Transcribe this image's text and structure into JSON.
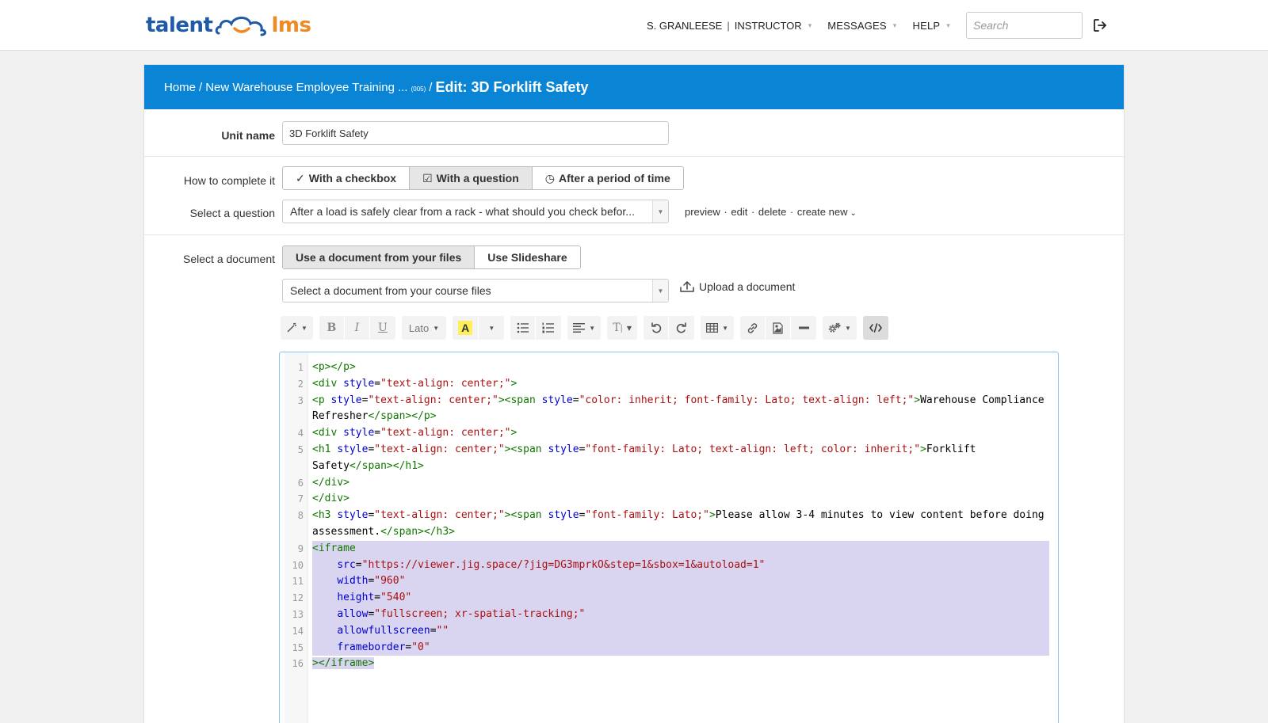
{
  "header": {
    "logo_left": "talent",
    "logo_right": "lms",
    "user_name": "S. GRANLEESE",
    "user_role": "INSTRUCTOR",
    "messages": "MESSAGES",
    "help": "HELP",
    "search_placeholder": "Search"
  },
  "breadcrumb": {
    "home": "Home",
    "course": "New Warehouse Employee Training ...",
    "count": "(005)",
    "current": "Edit: 3D Forklift Safety",
    "separator": "/"
  },
  "form": {
    "unit_name_label": "Unit name",
    "unit_name_value": "3D Forklift Safety",
    "complete_label": "How to complete it",
    "complete_options": [
      "With a checkbox",
      "With a question",
      "After a period of time"
    ],
    "complete_selected": "With a question",
    "question_label": "Select a question",
    "question_value": "After a load is safely clear from a rack - what should you check befor...",
    "question_links": [
      "preview",
      "edit",
      "delete",
      "create new"
    ],
    "document_label": "Select a document",
    "document_options": [
      "Use a document from your files",
      "Use Slideshare"
    ],
    "document_selected": "Use a document from your files",
    "document_select_value": "Select a document from your course files",
    "upload_label": "Upload a document"
  },
  "toolbar": {
    "font": "Lato",
    "bold": "B",
    "italic": "I",
    "underline": "U",
    "highlight": "A",
    "text_size": "T"
  },
  "code_lines": [
    {
      "n": "1",
      "segments": [
        [
          "tag",
          "<p></p>"
        ]
      ]
    },
    {
      "n": "2",
      "segments": [
        [
          "tag",
          "<div "
        ],
        [
          "attr",
          "style"
        ],
        [
          "txt",
          "="
        ],
        [
          "str",
          "\"text-align: center;\""
        ],
        [
          "tag",
          ">"
        ]
      ]
    },
    {
      "n": "3",
      "segments": [
        [
          "tag",
          "<p "
        ],
        [
          "attr",
          "style"
        ],
        [
          "txt",
          "="
        ],
        [
          "str",
          "\"text-align: center;\""
        ],
        [
          "tag",
          "><span "
        ],
        [
          "attr",
          "style"
        ],
        [
          "txt",
          "="
        ],
        [
          "str",
          "\"color: inherit; font-family: Lato; text-align: left;\""
        ],
        [
          "tag",
          ">"
        ],
        [
          "txt",
          "Warehouse Compliance Refresher"
        ],
        [
          "tag",
          "</span></p>"
        ]
      ]
    },
    {
      "n": "4",
      "segments": [
        [
          "tag",
          "<div "
        ],
        [
          "attr",
          "style"
        ],
        [
          "txt",
          "="
        ],
        [
          "str",
          "\"text-align: center;\""
        ],
        [
          "tag",
          ">"
        ]
      ]
    },
    {
      "n": "5",
      "segments": [
        [
          "tag",
          "<h1 "
        ],
        [
          "attr",
          "style"
        ],
        [
          "txt",
          "="
        ],
        [
          "str",
          "\"text-align: center;\""
        ],
        [
          "tag",
          "><span "
        ],
        [
          "attr",
          "style"
        ],
        [
          "txt",
          "="
        ],
        [
          "str",
          "\"font-family: Lato; text-align: left; color: inherit;\""
        ],
        [
          "tag",
          ">"
        ],
        [
          "txt",
          "Forklift Safety"
        ],
        [
          "tag",
          "</span></h1>"
        ]
      ]
    },
    {
      "n": "6",
      "segments": [
        [
          "tag",
          "</div>"
        ]
      ]
    },
    {
      "n": "7",
      "segments": [
        [
          "tag",
          "</div>"
        ]
      ]
    },
    {
      "n": "8",
      "segments": [
        [
          "tag",
          "<h3 "
        ],
        [
          "attr",
          "style"
        ],
        [
          "txt",
          "="
        ],
        [
          "str",
          "\"text-align: center;\""
        ],
        [
          "tag",
          "><span "
        ],
        [
          "attr",
          "style"
        ],
        [
          "txt",
          "="
        ],
        [
          "str",
          "\"font-family: Lato;\""
        ],
        [
          "tag",
          ">"
        ],
        [
          "txt",
          "Please allow 3-4 minutes to view content before doing assessment."
        ],
        [
          "tag",
          "</span></h3>"
        ]
      ]
    },
    {
      "n": "9",
      "sel": true,
      "segments": [
        [
          "tag",
          "<iframe"
        ]
      ]
    },
    {
      "n": "10",
      "sel": true,
      "segments": [
        [
          "txt",
          "    "
        ],
        [
          "attr",
          "src"
        ],
        [
          "txt",
          "="
        ],
        [
          "str",
          "\"https://viewer.jig.space/?jig=DG3mprkO&step=1&sbox=1&autoload=1\""
        ]
      ]
    },
    {
      "n": "11",
      "sel": true,
      "segments": [
        [
          "txt",
          "    "
        ],
        [
          "attr",
          "width"
        ],
        [
          "txt",
          "="
        ],
        [
          "str",
          "\"960\""
        ]
      ]
    },
    {
      "n": "12",
      "sel": true,
      "segments": [
        [
          "txt",
          "    "
        ],
        [
          "attr",
          "height"
        ],
        [
          "txt",
          "="
        ],
        [
          "str",
          "\"540\""
        ]
      ]
    },
    {
      "n": "13",
      "sel": true,
      "segments": [
        [
          "txt",
          "    "
        ],
        [
          "attr",
          "allow"
        ],
        [
          "txt",
          "="
        ],
        [
          "str",
          "\"fullscreen; xr-spatial-tracking;\""
        ]
      ]
    },
    {
      "n": "14",
      "sel": true,
      "segments": [
        [
          "txt",
          "    "
        ],
        [
          "attr",
          "allowfullscreen"
        ],
        [
          "txt",
          "="
        ],
        [
          "str",
          "\"\""
        ]
      ]
    },
    {
      "n": "15",
      "sel": true,
      "segments": [
        [
          "txt",
          "    "
        ],
        [
          "attr",
          "frameborder"
        ],
        [
          "txt",
          "="
        ],
        [
          "str",
          "\"0\""
        ]
      ]
    },
    {
      "n": "16",
      "sel": "partial",
      "segments": [
        [
          "tag",
          "></iframe>"
        ]
      ]
    }
  ]
}
